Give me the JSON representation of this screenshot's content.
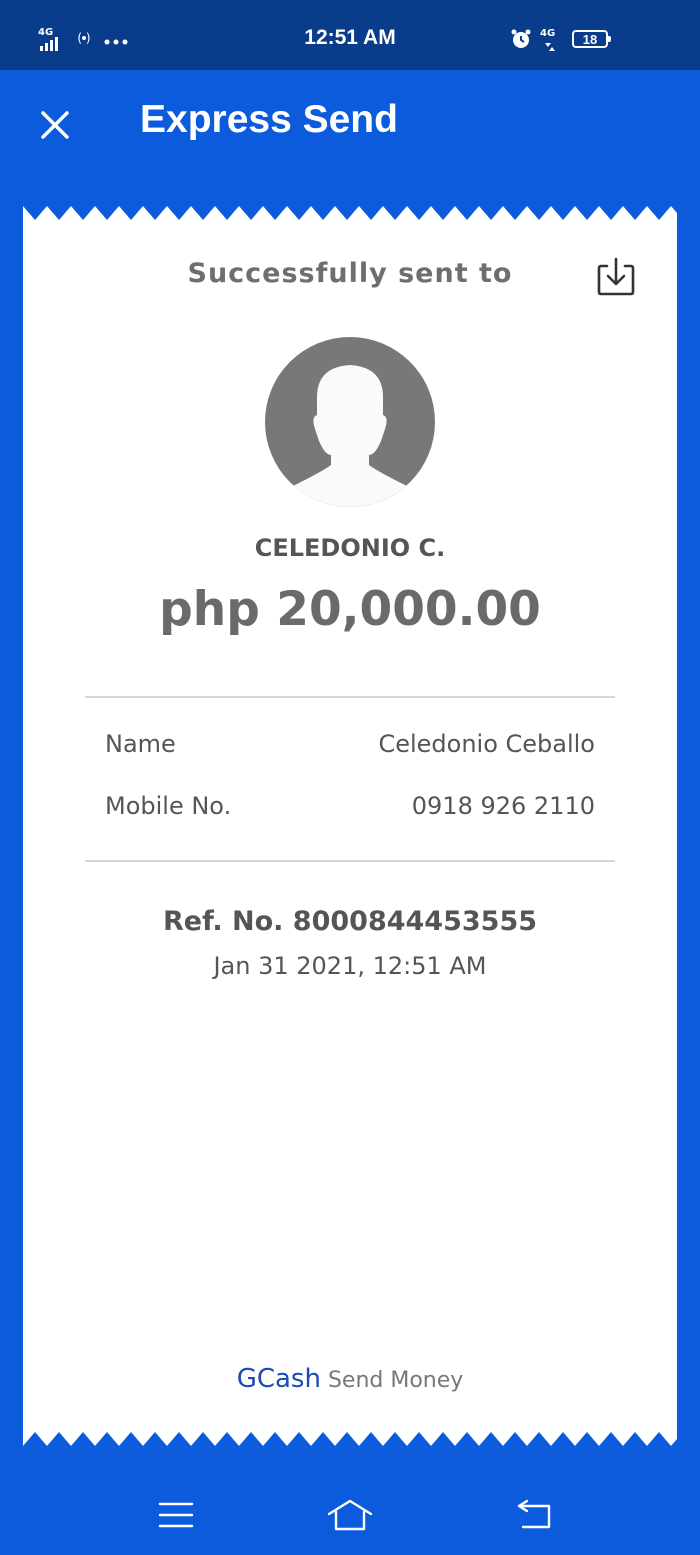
{
  "status_bar": {
    "time": "12:51 AM",
    "left_icons": [
      "4g-signal-icon",
      "hotspot-icon",
      "more-dots-icon"
    ],
    "right_icons": [
      "alarm-icon",
      "4g-data-icon"
    ],
    "battery": "18",
    "left_network": "4G",
    "right_network": "4G"
  },
  "app_bar": {
    "title": "Express Send",
    "close_icon": "close-icon"
  },
  "receipt": {
    "heading": "Successfully sent to",
    "download_icon": "download-icon",
    "avatar_icon": "user-avatar-icon",
    "recipient_short": "CELEDONIO C.",
    "amount": "php 20,000.00",
    "details": [
      {
        "label": "Name",
        "value": "Celedonio Ceballo"
      },
      {
        "label": "Mobile No.",
        "value": "0918 926 2110"
      }
    ],
    "reference": "Ref. No. 8000844453555",
    "datetime": "Jan 31 2021, 12:51 AM",
    "footer_brand": "GCash",
    "footer_text": "Send Money"
  },
  "nav_bar": {
    "icons": [
      "menu-icon",
      "home-icon",
      "back-icon"
    ]
  },
  "colors": {
    "background": "#0b5bdc",
    "status_bar": "#0a3c8c",
    "receipt": "#ffffff",
    "brand": "#1a49b8"
  }
}
